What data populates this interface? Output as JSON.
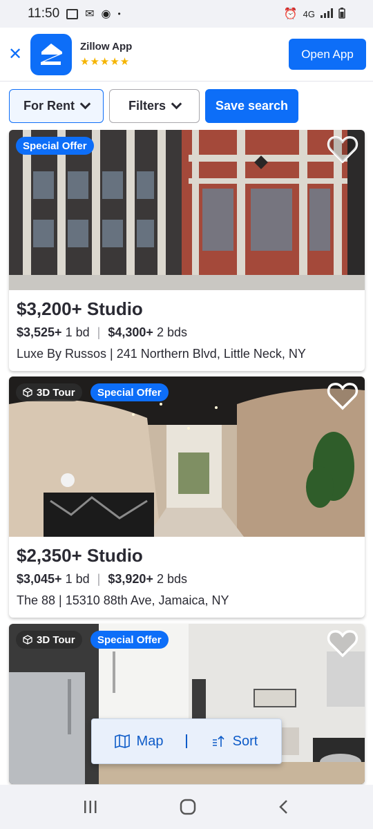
{
  "status_bar": {
    "time": "11:50",
    "network": "4G"
  },
  "banner": {
    "app_name": "Zillow App",
    "rating_stars": "★★★★★",
    "open_label": "Open App"
  },
  "filters": {
    "rent_label": "For Rent",
    "filters_label": "Filters",
    "save_label": "Save search"
  },
  "listings": [
    {
      "badges": [
        "Special Offer"
      ],
      "price": "$3,200+ Studio",
      "unit1_price": "$3,525+",
      "unit1_beds": "1 bd",
      "unit2_price": "$4,300+",
      "unit2_beds": "2 bds",
      "address": "Luxe By Russos | 241 Northern Blvd, Little Neck, NY"
    },
    {
      "badges": [
        "3D Tour",
        "Special Offer"
      ],
      "price": "$2,350+ Studio",
      "unit1_price": "$3,045+",
      "unit1_beds": "1 bd",
      "unit2_price": "$3,920+",
      "unit2_beds": "2 bds",
      "address": "The 88 | 15310 88th Ave, Jamaica, NY"
    },
    {
      "badges": [
        "3D Tour",
        "Special Offer"
      ]
    }
  ],
  "floating": {
    "map_label": "Map",
    "sort_label": "Sort"
  },
  "colors": {
    "accent": "#0d6ef8",
    "text": "#2a2a33",
    "star": "#f5b400"
  }
}
